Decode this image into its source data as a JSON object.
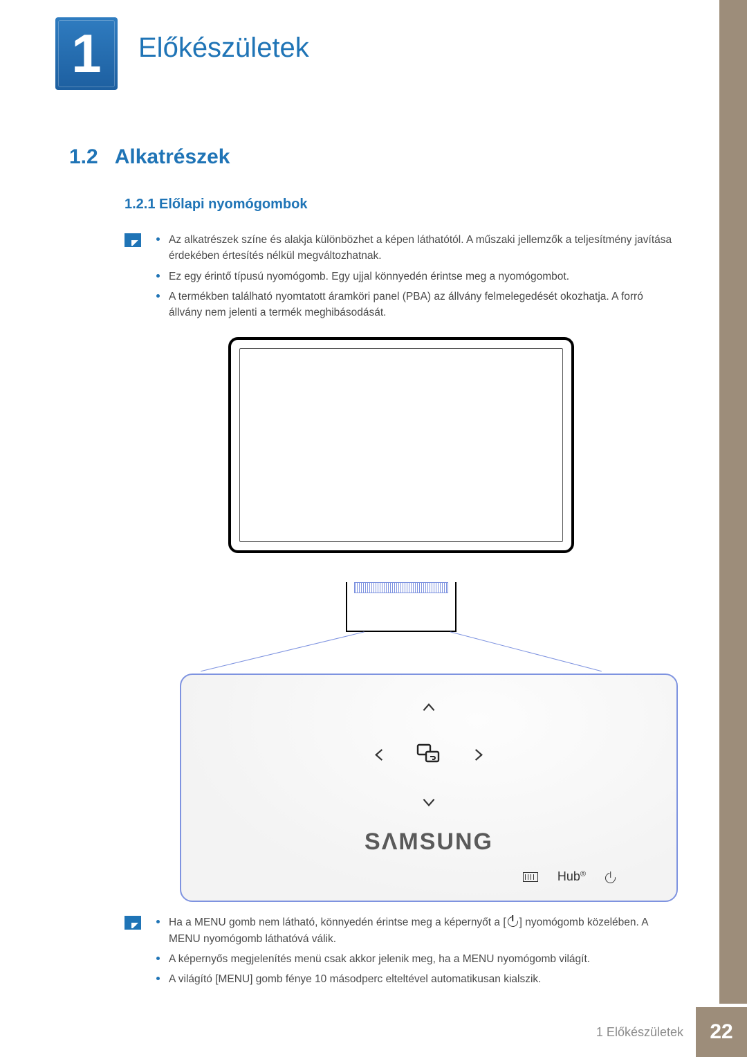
{
  "chapter": {
    "number": "1",
    "title": "Előkészületek"
  },
  "section": {
    "number": "1.2",
    "title": "Alkatrészek"
  },
  "subsection": {
    "number": "1.2.1",
    "title": "Előlapi nyomógombok"
  },
  "subsection_combined": "1.2.1 Előlapi nyomógombok",
  "notes_top": [
    "Az alkatrészek színe és alakja különbözhet a képen láthatótól. A műszaki jellemzők a teljesítmény javítása érdekében értesítés nélkül megváltozhatnak.",
    "Ez egy érintő típusú nyomógomb. Egy ujjal könnyedén érintse meg a nyomógombot.",
    "A termékben található nyomtatott áramköri panel (PBA) az állvány felmelegedését okozhatja. A forró állvány nem jelenti a termék meghibásodását."
  ],
  "panel": {
    "brand": "SΛMSUNG",
    "hub_label": "Hub",
    "icons": {
      "up": "arrow-up",
      "down": "arrow-down",
      "left": "arrow-left",
      "right": "arrow-right",
      "center": "screen-swap",
      "keyboard": "keyboard",
      "power": "power"
    }
  },
  "notes_bottom": [
    {
      "pre": "Ha a MENU gomb nem látható, könnyedén érintse meg a képernyőt a [",
      "post": "] nyomógomb közelében. A MENU nyomógomb láthatóvá válik."
    },
    "A képernyős megjelenítés menü csak akkor jelenik meg, ha a MENU nyomógomb világít.",
    "A világító [MENU] gomb fénye 10 másodperc elteltével automatikusan kialszik."
  ],
  "footer": {
    "label": "1 Előkészületek",
    "page": "22"
  }
}
